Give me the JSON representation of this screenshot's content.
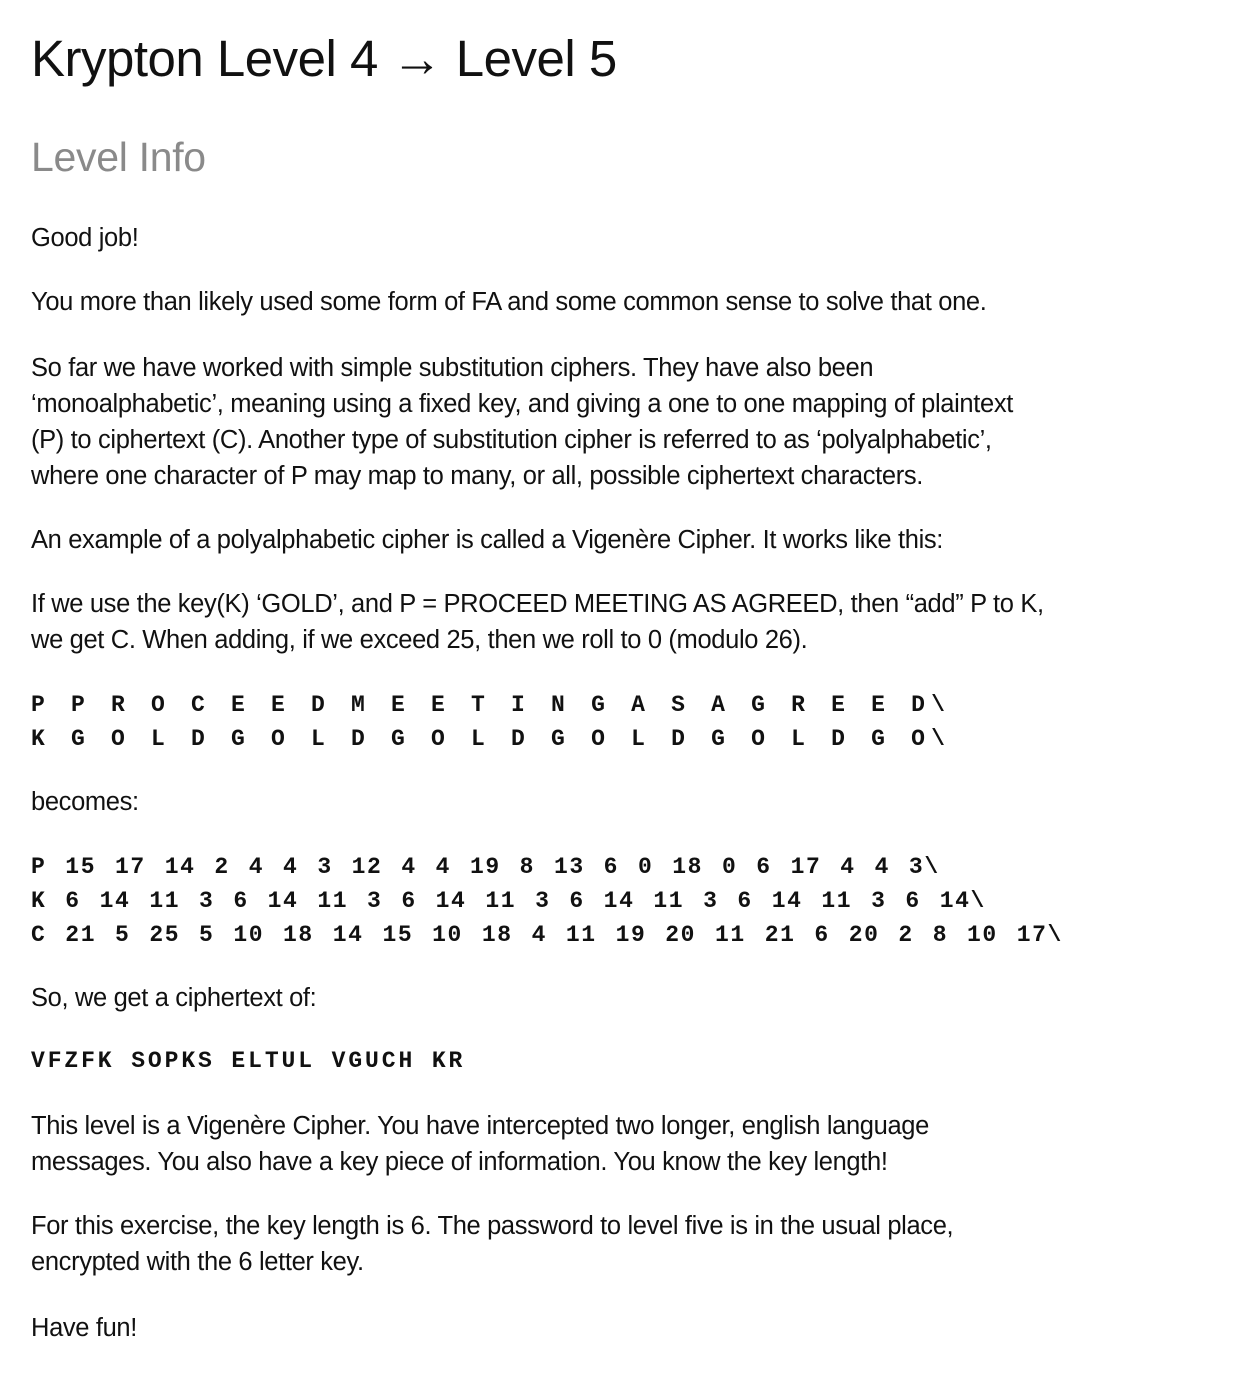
{
  "title": "Krypton Level 4 → Level 5",
  "section_heading": "Level Info",
  "paragraphs": {
    "p1": "Good job!",
    "p2": "You more than likely used some form of FA and some common sense to solve that one.",
    "p3": [
      "So far we have worked with simple substitution ciphers. They have also been",
      "‘monoalphabetic’, meaning using a fixed key, and giving a one to one mapping of plaintext",
      "(P) to ciphertext (C). Another type of substitution cipher is referred to as ‘polyalphabetic’,",
      "where one character of P may map to many, or all, possible ciphertext characters."
    ],
    "p4": "An example of a polyalphabetic cipher is called a Vigenère Cipher. It works like this:",
    "p5": [
      "If we use the key(K) ‘GOLD’, and P = PROCEED MEETING AS AGREED, then “add” P to K,",
      "we get C. When adding, if we exceed 25, then we roll to 0 (modulo 26)."
    ],
    "p6": "becomes:",
    "p7": "So, we get a ciphertext of:",
    "p8": [
      "This level is a Vigenère Cipher. You have intercepted two longer, english language",
      "messages. You also have a key piece of information. You know the key length!"
    ],
    "p9": [
      "For this exercise, the key length is 6. The password to level five is in the usual place,",
      "encrypted with the 6 letter key."
    ],
    "p10": "Have fun!"
  },
  "code_blocks": {
    "letters": [
      "P P R O C E E D M E E T I N G A S A G R E E D\\",
      "K G O L D G O L D G O L D G O L D G O L D G O\\"
    ],
    "numbers": [
      "P 15 17 14 2 4 4 3 12 4 4 19 8 13 6 0 18 0 6 17 4 4 3\\",
      "K 6 14 11 3 6 14 11 3 6 14 11 3 6 14 11 3 6 14 11 3 6 14\\",
      "C 21 5 25 5 10 18 14 15 10 18 4 11 19 20 11 21 6 20 2 8 10 17\\"
    ],
    "ciphertext": "VFZFK SOPKS ELTUL VGUCH KR"
  }
}
